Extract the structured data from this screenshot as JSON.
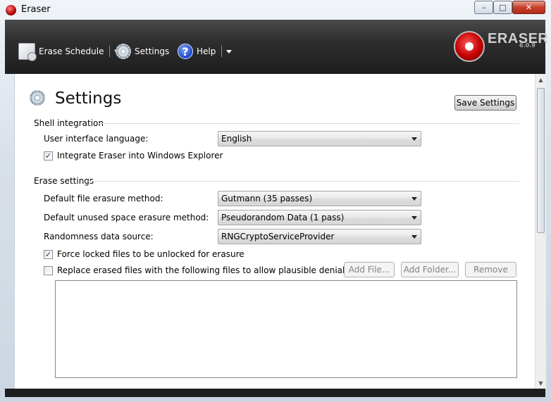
{
  "window": {
    "title": "Eraser",
    "controls": {
      "minimize": "–",
      "maximize": "□",
      "close": "✕"
    }
  },
  "toolbar": {
    "erase_schedule": "Erase Schedule",
    "settings": "Settings",
    "help": "Help",
    "help_glyph": "?"
  },
  "branding": {
    "name": "ERASER",
    "version": "6.0.9"
  },
  "page": {
    "title": "Settings",
    "save_button": "Save Settings"
  },
  "shell_integration": {
    "heading": "Shell integration",
    "language_label": "User interface language:",
    "language_value": "English",
    "integrate_explorer": {
      "label": "Integrate Eraser into Windows Explorer",
      "checked": true,
      "mark": "✓"
    }
  },
  "erase_settings": {
    "heading": "Erase settings",
    "file_method_label": "Default file erasure method:",
    "file_method_value": "Gutmann (35 passes)",
    "unused_method_label": "Default unused space erasure method:",
    "unused_method_value": "Pseudorandom Data (1 pass)",
    "randomness_label": "Randomness data source:",
    "randomness_value": "RNGCryptoServiceProvider",
    "force_unlock": {
      "label": "Force locked files to be unlocked for erasure",
      "checked": true,
      "mark": "✓"
    },
    "plausible_deniability": {
      "label": "Replace erased files with the following files to allow plausible deniability",
      "checked": false,
      "mark": ""
    },
    "add_file_button": "Add File...",
    "add_folder_button": "Add Folder...",
    "remove_button": "Remove"
  },
  "scrollbar": {
    "up": "▲",
    "down": "▼"
  }
}
